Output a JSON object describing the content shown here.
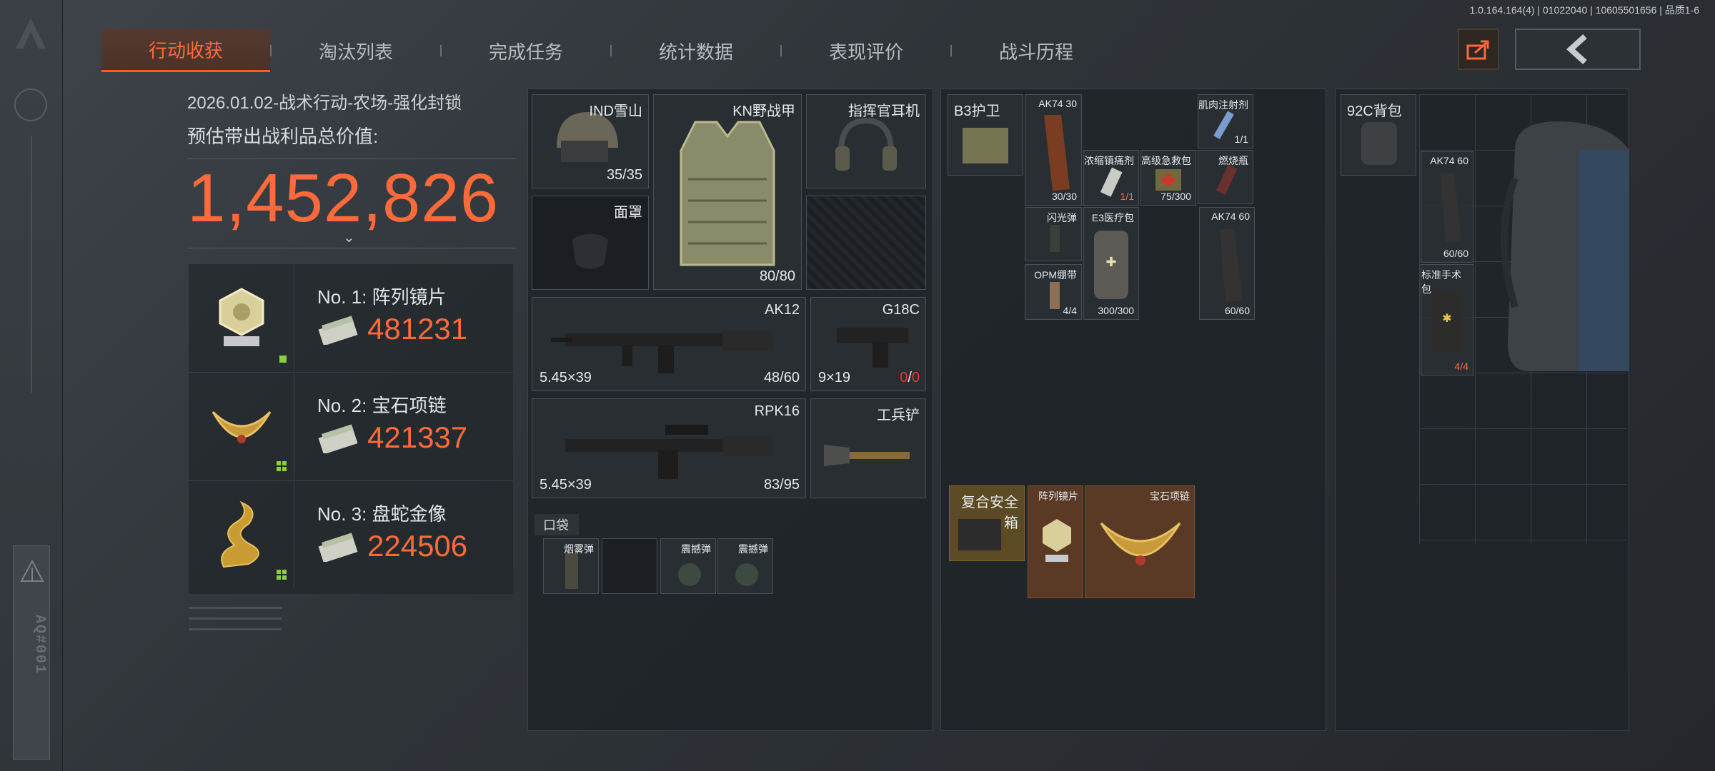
{
  "version": "1.0.164.164(4) | 01022040 | 10605501656 | 品质1-6",
  "tabs": [
    {
      "label": "行动收获"
    },
    {
      "label": "淘汰列表"
    },
    {
      "label": "完成任务"
    },
    {
      "label": "统计数据"
    },
    {
      "label": "表现评价"
    },
    {
      "label": "战斗历程"
    }
  ],
  "left_rail": {
    "code": "AQ#001"
  },
  "summary": {
    "operation": "2026.01.02-战术行动-农场-强化封锁",
    "total_label": "预估带出战利品总价值:",
    "total_value": "1,452,826"
  },
  "top_items": [
    {
      "rank": "No. 1: 阵列镜片",
      "value": "481231"
    },
    {
      "rank": "No. 2: 宝石项链",
      "value": "421337"
    },
    {
      "rank": "No. 3: 盘蛇金像",
      "value": "224506"
    }
  ],
  "equipment": {
    "helmet": {
      "name": "IND雪山",
      "durability": "35/35"
    },
    "armor": {
      "name": "KN野战甲",
      "durability": "80/80"
    },
    "headset": {
      "name": "指挥官耳机"
    },
    "mask": {
      "name": "面罩"
    },
    "primary": {
      "name": "AK12",
      "caliber": "5.45×39",
      "ammo": "48/60"
    },
    "sidearm": {
      "name": "G18C",
      "caliber": "9×19",
      "ammo_a": "0",
      "ammo_b": "0"
    },
    "secondary": {
      "name": "RPK16",
      "caliber": "5.45×39",
      "ammo": "83/95"
    },
    "melee": {
      "name": "工兵铲"
    },
    "pocket_label": "口袋",
    "pockets": [
      {
        "name": "烟雾弹"
      },
      {
        "name": ""
      },
      {
        "name": "震撼弹"
      },
      {
        "name": "震撼弹"
      }
    ]
  },
  "rig": {
    "name": "B3护卫",
    "items": [
      {
        "name": "AK74 30",
        "count": "30/30"
      },
      {
        "name": "肌肉注射剂",
        "count": "1/1"
      },
      {
        "name": "浓缩镇痛剂",
        "count": "1/1"
      },
      {
        "name": "高级急救包",
        "count": "75/300"
      },
      {
        "name": "燃烧瓶",
        "count": ""
      },
      {
        "name": "闪光弹",
        "count": ""
      },
      {
        "name": "E3医疗包",
        "count": "300/300"
      },
      {
        "name": "AK74 60",
        "count": "60/60"
      },
      {
        "name": "OPM绷带",
        "count": "4/4"
      }
    ],
    "secure": {
      "name": "复合安全箱",
      "items": [
        {
          "name": "阵列镜片"
        },
        {
          "name": "宝石项链"
        }
      ]
    }
  },
  "backpack": {
    "name": "92C背包",
    "items": [
      {
        "name": "AK74 60",
        "count": "60/60"
      },
      {
        "name": "标准手术包",
        "count": "4/4"
      }
    ]
  }
}
